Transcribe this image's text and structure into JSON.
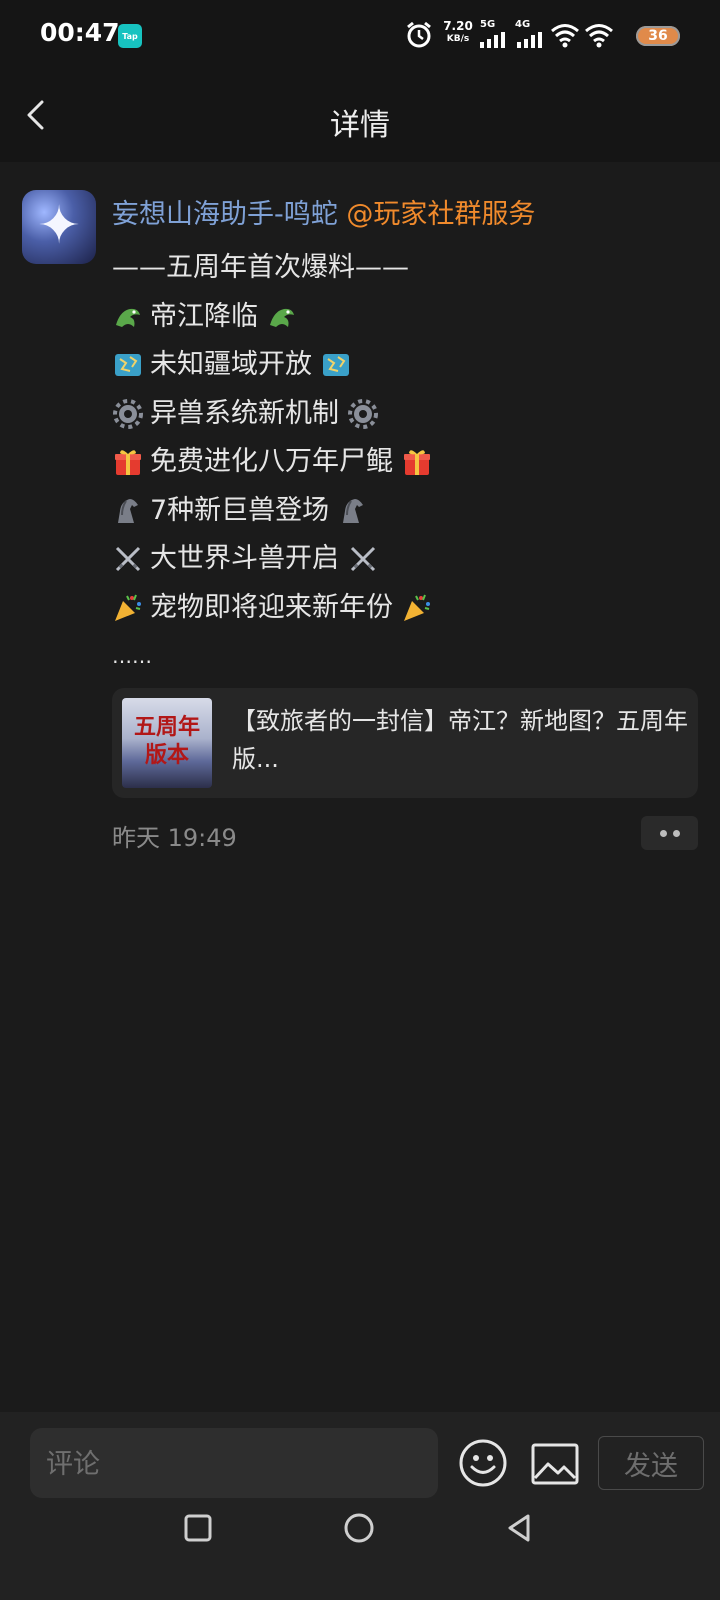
{
  "status_bar": {
    "time": "00:47",
    "app_badge": "Tap",
    "speed_value": "7.20",
    "speed_unit": "KB/s",
    "net_5g": "5G",
    "net_4g": "4G",
    "battery": "36"
  },
  "header": {
    "title": "详情"
  },
  "post": {
    "author": "妄想山海助手-鸣蛇",
    "mention": "@玩家社群服务",
    "lines": [
      {
        "emoji": "",
        "text": "——五周年首次爆料——"
      },
      {
        "emoji": "dragon",
        "text": "帝江降临"
      },
      {
        "emoji": "map",
        "text": "未知疆域开放"
      },
      {
        "emoji": "gear",
        "text": "异兽系统新机制"
      },
      {
        "emoji": "gift",
        "text": "免费进化八万年尸鲲"
      },
      {
        "emoji": "horse",
        "text": "7种新巨兽登场"
      },
      {
        "emoji": "swords",
        "text": "大世界斗兽开启"
      },
      {
        "emoji": "party",
        "text": "宠物即将迎来新年份"
      },
      {
        "emoji": "",
        "text": "……"
      }
    ],
    "link_card": {
      "thumb_line1": "五周年",
      "thumb_line2": "版本",
      "text": "【致旅者的一封信】帝江？新地图？五周年版..."
    },
    "timestamp": "昨天 19:49"
  },
  "composer": {
    "placeholder": "评论",
    "send_label": "发送"
  },
  "colors": {
    "author": "#7fa1d6",
    "mention": "#f08a2c",
    "background": "#1b1b1b"
  }
}
